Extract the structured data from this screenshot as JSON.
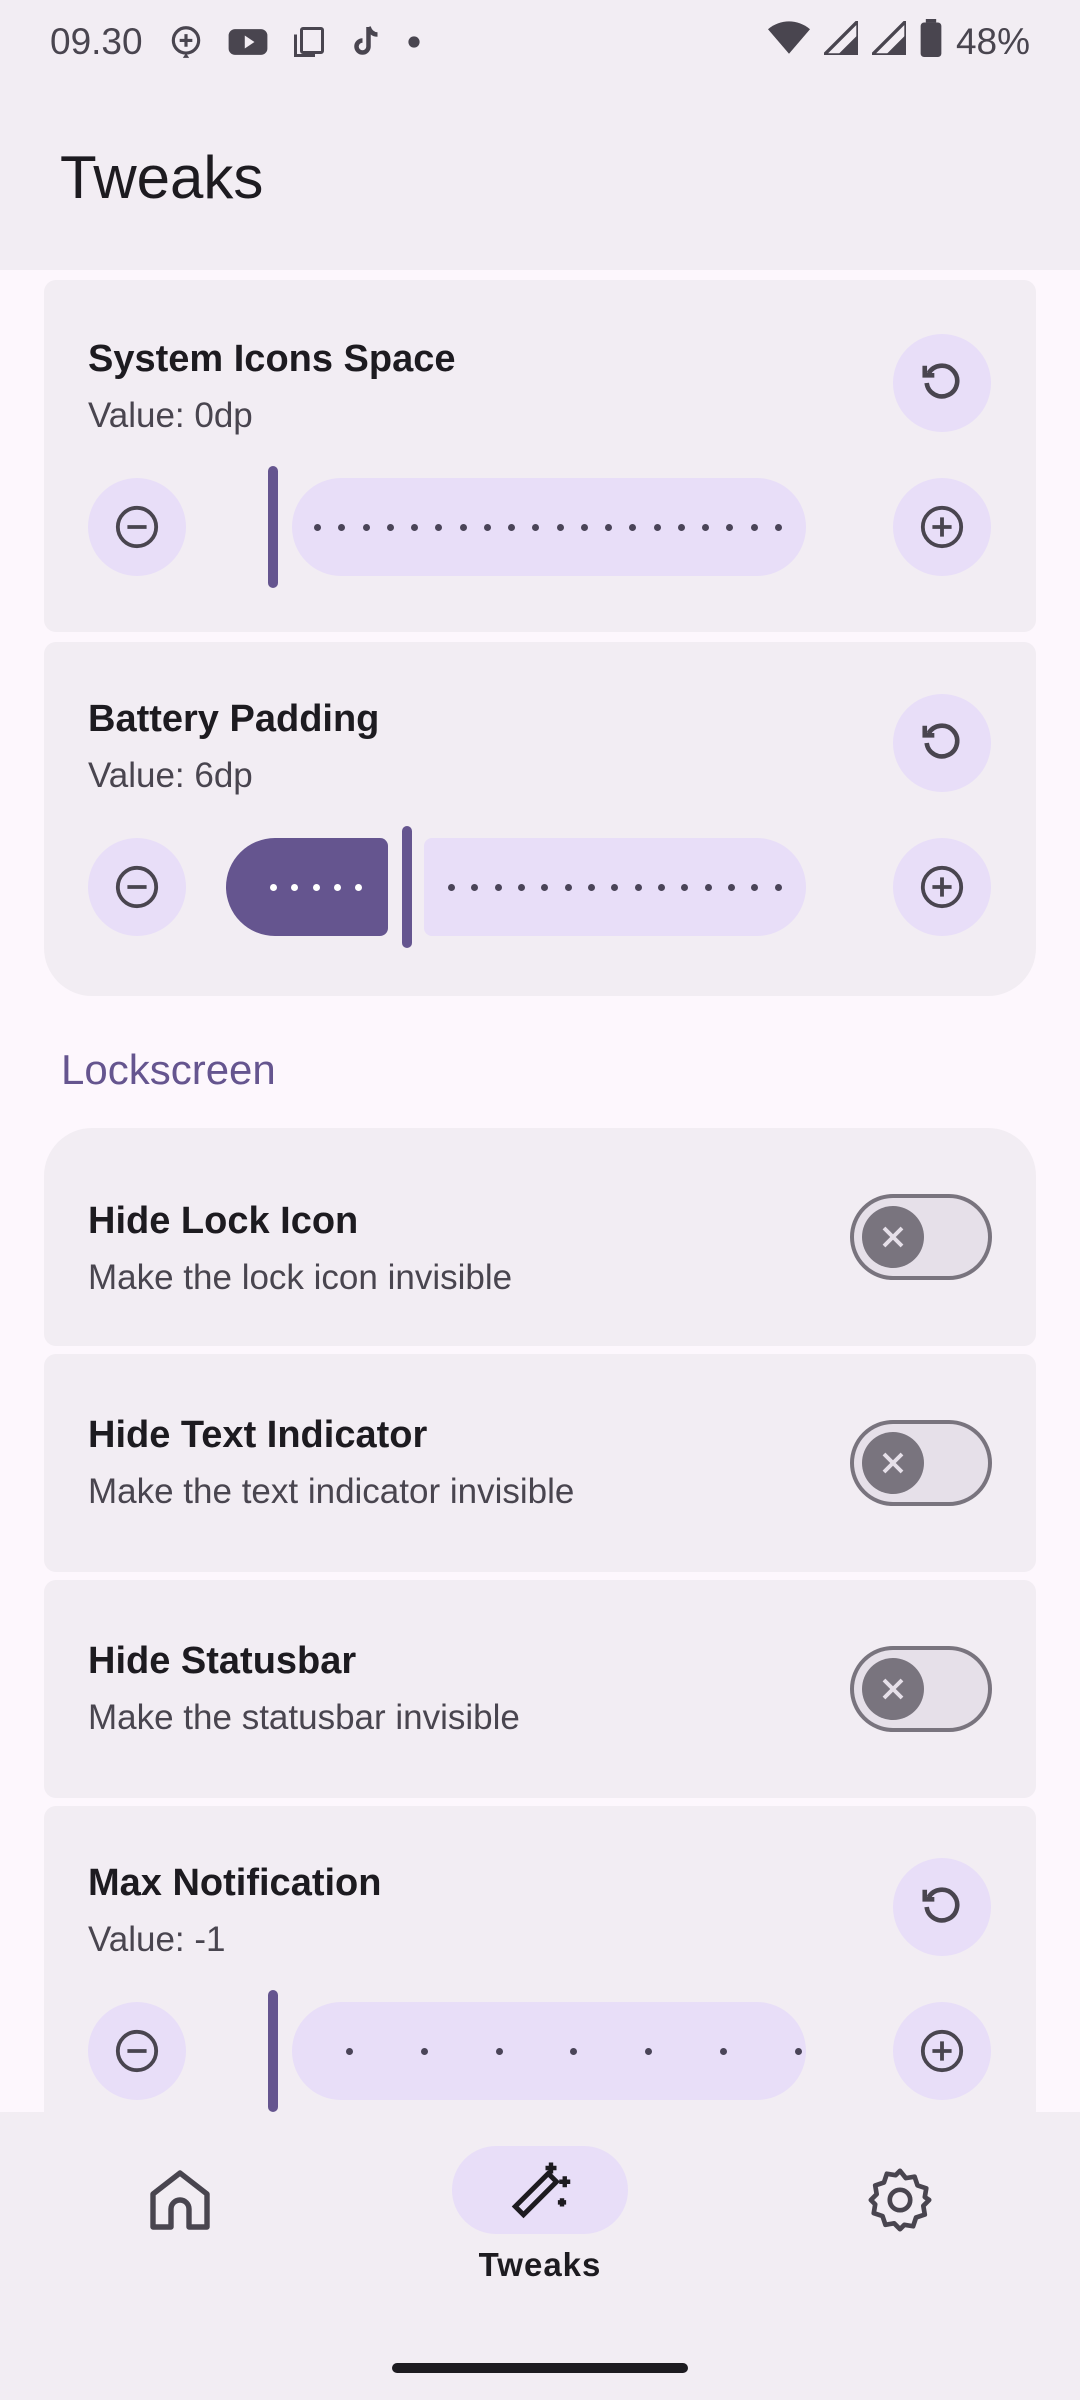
{
  "status_bar": {
    "time": "09.30",
    "battery": "48%",
    "notification_icons": [
      "maps-pin-icon",
      "youtube-icon",
      "copy-icon",
      "tiktok-icon",
      "more-dot-icon"
    ],
    "system_icons": [
      "wifi-icon",
      "signal-icon",
      "signal-icon",
      "battery-icon"
    ]
  },
  "app_bar": {
    "title": "Tweaks"
  },
  "cards": {
    "system_icons_space": {
      "title": "System Icons Space",
      "value_text": "Value: 0dp",
      "slider_fraction": 0.0
    },
    "battery_padding": {
      "title": "Battery Padding",
      "value_text": "Value: 6dp",
      "slider_fraction": 0.24
    },
    "max_notification": {
      "title": "Max Notification",
      "value_text": "Value: -1",
      "slider_fraction": 0.0
    }
  },
  "section_lockscreen": "Lockscreen",
  "toggles": {
    "hide_lock_icon": {
      "title": "Hide Lock Icon",
      "subtitle": "Make the lock icon invisible",
      "checked": false
    },
    "hide_text_indicator": {
      "title": "Hide Text Indicator",
      "subtitle": "Make the text indicator invisible",
      "checked": false
    },
    "hide_statusbar": {
      "title": "Hide Statusbar",
      "subtitle": "Make the statusbar invisible",
      "checked": false
    }
  },
  "bottom_nav": {
    "items": [
      {
        "icon": "home-icon",
        "label": ""
      },
      {
        "icon": "magic-wand-icon",
        "label": "Tweaks",
        "selected": true
      },
      {
        "icon": "settings-gear-icon",
        "label": ""
      }
    ]
  },
  "colors": {
    "primary": "#65558f",
    "secondary_container": "#e8def8",
    "surface_container": "#f2edf3",
    "background": "#fdf7fd"
  }
}
